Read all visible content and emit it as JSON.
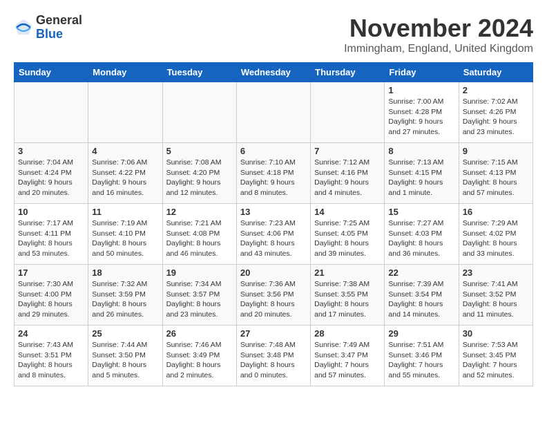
{
  "header": {
    "logo_general": "General",
    "logo_blue": "Blue",
    "month_title": "November 2024",
    "location": "Immingham, England, United Kingdom"
  },
  "columns": [
    "Sunday",
    "Monday",
    "Tuesday",
    "Wednesday",
    "Thursday",
    "Friday",
    "Saturday"
  ],
  "rows": [
    [
      {
        "day": "",
        "info": ""
      },
      {
        "day": "",
        "info": ""
      },
      {
        "day": "",
        "info": ""
      },
      {
        "day": "",
        "info": ""
      },
      {
        "day": "",
        "info": ""
      },
      {
        "day": "1",
        "info": "Sunrise: 7:00 AM\nSunset: 4:28 PM\nDaylight: 9 hours\nand 27 minutes."
      },
      {
        "day": "2",
        "info": "Sunrise: 7:02 AM\nSunset: 4:26 PM\nDaylight: 9 hours\nand 23 minutes."
      }
    ],
    [
      {
        "day": "3",
        "info": "Sunrise: 7:04 AM\nSunset: 4:24 PM\nDaylight: 9 hours\nand 20 minutes."
      },
      {
        "day": "4",
        "info": "Sunrise: 7:06 AM\nSunset: 4:22 PM\nDaylight: 9 hours\nand 16 minutes."
      },
      {
        "day": "5",
        "info": "Sunrise: 7:08 AM\nSunset: 4:20 PM\nDaylight: 9 hours\nand 12 minutes."
      },
      {
        "day": "6",
        "info": "Sunrise: 7:10 AM\nSunset: 4:18 PM\nDaylight: 9 hours\nand 8 minutes."
      },
      {
        "day": "7",
        "info": "Sunrise: 7:12 AM\nSunset: 4:16 PM\nDaylight: 9 hours\nand 4 minutes."
      },
      {
        "day": "8",
        "info": "Sunrise: 7:13 AM\nSunset: 4:15 PM\nDaylight: 9 hours\nand 1 minute."
      },
      {
        "day": "9",
        "info": "Sunrise: 7:15 AM\nSunset: 4:13 PM\nDaylight: 8 hours\nand 57 minutes."
      }
    ],
    [
      {
        "day": "10",
        "info": "Sunrise: 7:17 AM\nSunset: 4:11 PM\nDaylight: 8 hours\nand 53 minutes."
      },
      {
        "day": "11",
        "info": "Sunrise: 7:19 AM\nSunset: 4:10 PM\nDaylight: 8 hours\nand 50 minutes."
      },
      {
        "day": "12",
        "info": "Sunrise: 7:21 AM\nSunset: 4:08 PM\nDaylight: 8 hours\nand 46 minutes."
      },
      {
        "day": "13",
        "info": "Sunrise: 7:23 AM\nSunset: 4:06 PM\nDaylight: 8 hours\nand 43 minutes."
      },
      {
        "day": "14",
        "info": "Sunrise: 7:25 AM\nSunset: 4:05 PM\nDaylight: 8 hours\nand 39 minutes."
      },
      {
        "day": "15",
        "info": "Sunrise: 7:27 AM\nSunset: 4:03 PM\nDaylight: 8 hours\nand 36 minutes."
      },
      {
        "day": "16",
        "info": "Sunrise: 7:29 AM\nSunset: 4:02 PM\nDaylight: 8 hours\nand 33 minutes."
      }
    ],
    [
      {
        "day": "17",
        "info": "Sunrise: 7:30 AM\nSunset: 4:00 PM\nDaylight: 8 hours\nand 29 minutes."
      },
      {
        "day": "18",
        "info": "Sunrise: 7:32 AM\nSunset: 3:59 PM\nDaylight: 8 hours\nand 26 minutes."
      },
      {
        "day": "19",
        "info": "Sunrise: 7:34 AM\nSunset: 3:57 PM\nDaylight: 8 hours\nand 23 minutes."
      },
      {
        "day": "20",
        "info": "Sunrise: 7:36 AM\nSunset: 3:56 PM\nDaylight: 8 hours\nand 20 minutes."
      },
      {
        "day": "21",
        "info": "Sunrise: 7:38 AM\nSunset: 3:55 PM\nDaylight: 8 hours\nand 17 minutes."
      },
      {
        "day": "22",
        "info": "Sunrise: 7:39 AM\nSunset: 3:54 PM\nDaylight: 8 hours\nand 14 minutes."
      },
      {
        "day": "23",
        "info": "Sunrise: 7:41 AM\nSunset: 3:52 PM\nDaylight: 8 hours\nand 11 minutes."
      }
    ],
    [
      {
        "day": "24",
        "info": "Sunrise: 7:43 AM\nSunset: 3:51 PM\nDaylight: 8 hours\nand 8 minutes."
      },
      {
        "day": "25",
        "info": "Sunrise: 7:44 AM\nSunset: 3:50 PM\nDaylight: 8 hours\nand 5 minutes."
      },
      {
        "day": "26",
        "info": "Sunrise: 7:46 AM\nSunset: 3:49 PM\nDaylight: 8 hours\nand 2 minutes."
      },
      {
        "day": "27",
        "info": "Sunrise: 7:48 AM\nSunset: 3:48 PM\nDaylight: 8 hours\nand 0 minutes."
      },
      {
        "day": "28",
        "info": "Sunrise: 7:49 AM\nSunset: 3:47 PM\nDaylight: 7 hours\nand 57 minutes."
      },
      {
        "day": "29",
        "info": "Sunrise: 7:51 AM\nSunset: 3:46 PM\nDaylight: 7 hours\nand 55 minutes."
      },
      {
        "day": "30",
        "info": "Sunrise: 7:53 AM\nSunset: 3:45 PM\nDaylight: 7 hours\nand 52 minutes."
      }
    ]
  ]
}
